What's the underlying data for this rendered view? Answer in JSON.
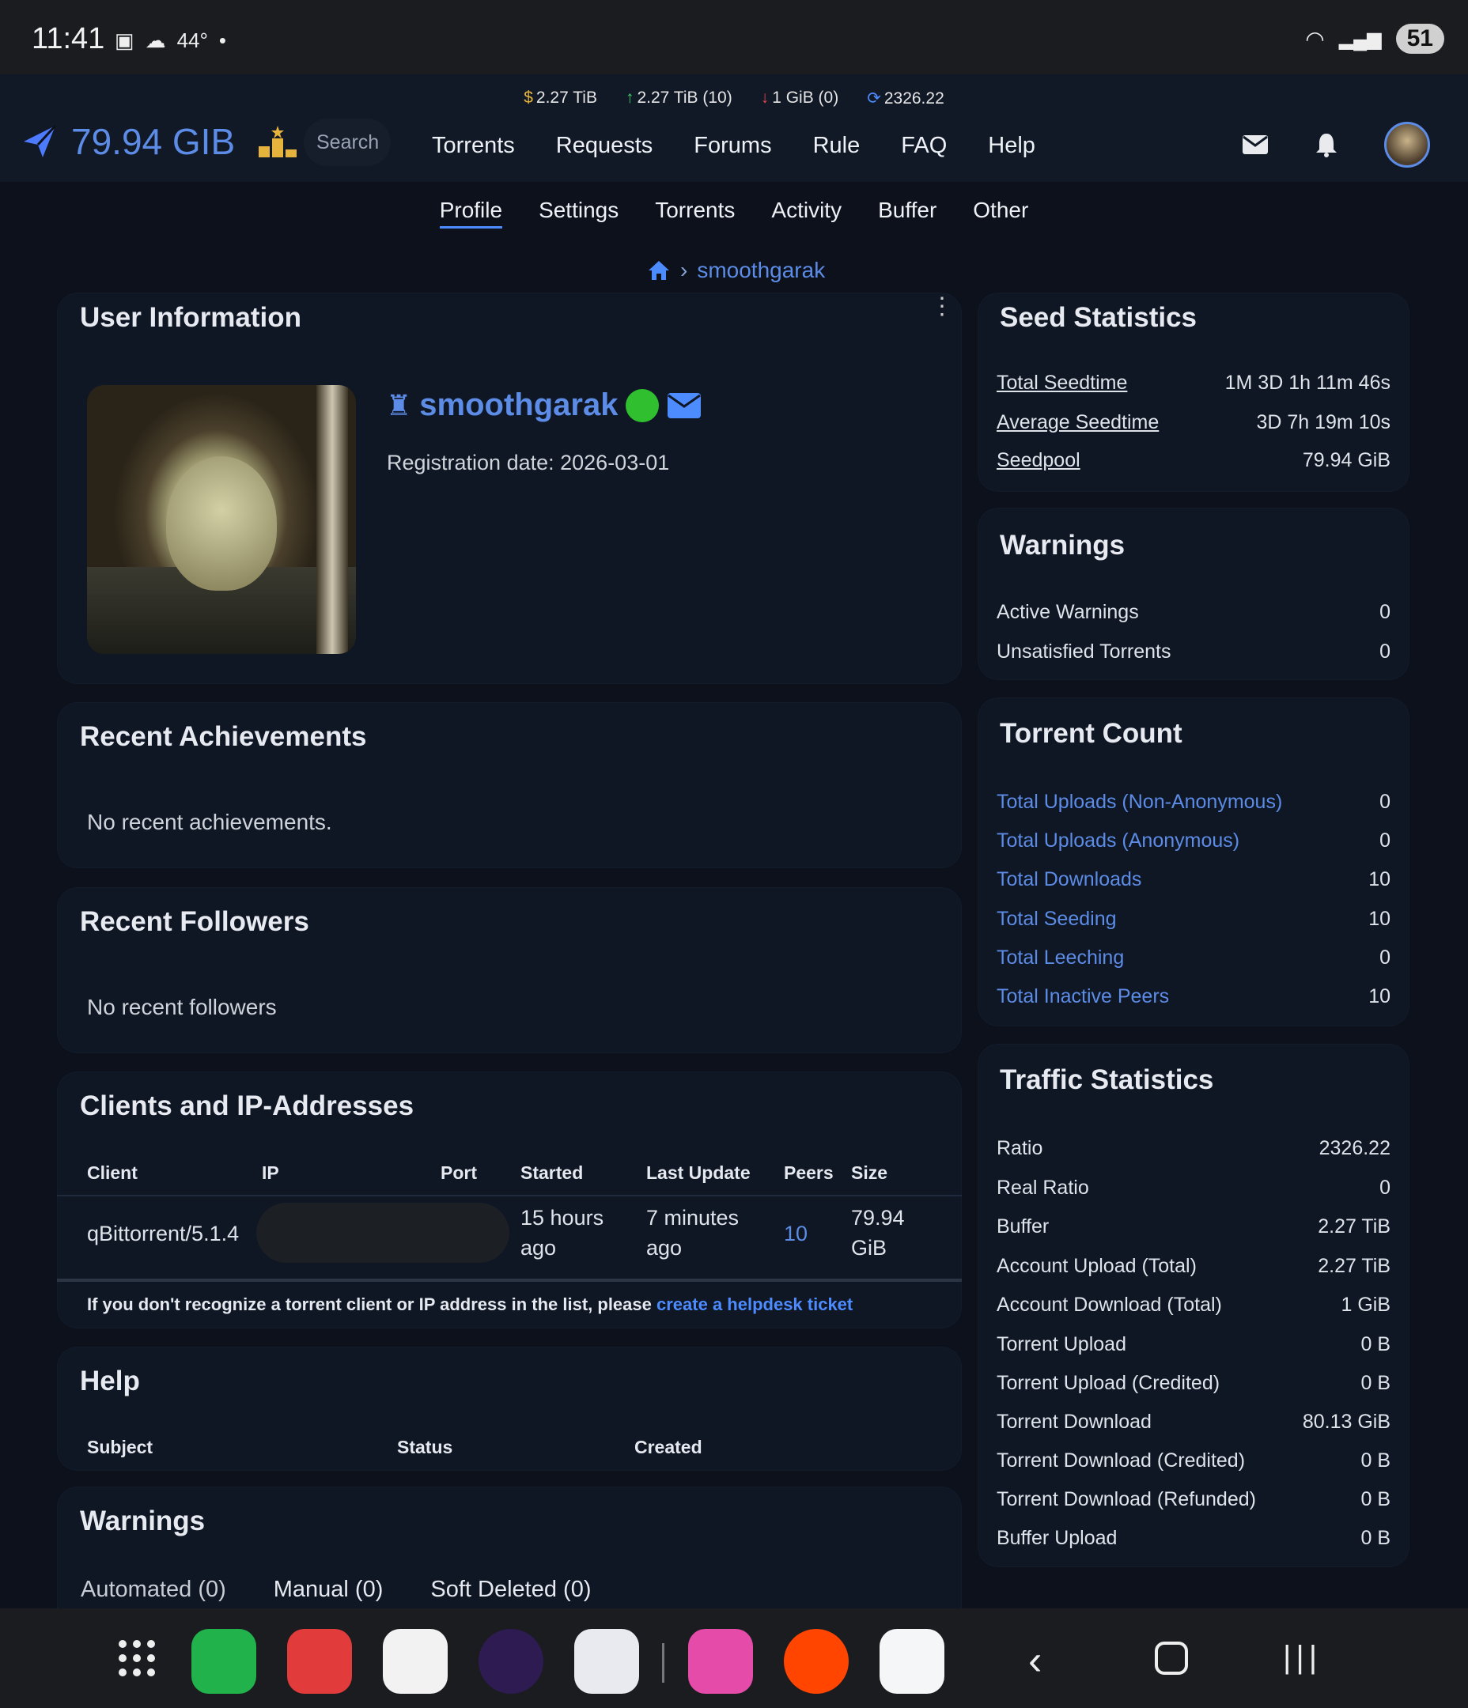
{
  "status_bar": {
    "time": "11:41",
    "temperature": "44°",
    "battery": "51"
  },
  "header": {
    "stats": {
      "bounty": "2.27 TiB",
      "upload": "2.27 TiB (10)",
      "download": "1 GiB (0)",
      "ratio": "2326.22"
    },
    "seedpool": "79.94 GIB",
    "search_placeholder": "Search",
    "nav": [
      "Torrents",
      "Requests",
      "Forums",
      "Rule",
      "FAQ",
      "Help"
    ]
  },
  "subnav": [
    "Profile",
    "Settings",
    "Torrents",
    "Activity",
    "Buffer",
    "Other"
  ],
  "breadcrumb": {
    "user": "smoothgarak"
  },
  "user_info": {
    "title": "User Information",
    "username": "smoothgarak",
    "registration": "Registration date: 2026-03-01"
  },
  "recent_achievements": {
    "title": "Recent Achievements",
    "empty": "No recent achievements."
  },
  "recent_followers": {
    "title": "Recent Followers",
    "empty": "No recent followers"
  },
  "clients": {
    "title": "Clients and IP-Addresses",
    "columns": [
      "Client",
      "IP",
      "Port",
      "Started",
      "Last Update",
      "Peers",
      "Size"
    ],
    "row": {
      "client": "qBittorrent/5.1.4",
      "started_1": "15 hours",
      "started_2": "ago",
      "last_update_1": "7 minutes",
      "last_update_2": "ago",
      "peers": "10",
      "size_1": "79.94",
      "size_2": "GiB"
    },
    "note": "If you don't recognize a torrent client or IP address in the list, please",
    "note_link": "create a helpdesk ticket"
  },
  "help": {
    "title": "Help",
    "columns": [
      "Subject",
      "Status",
      "Created"
    ]
  },
  "warnings_left": {
    "title": "Warnings",
    "tabs": [
      "Automated (0)",
      "Manual (0)",
      "Soft Deleted (0)"
    ]
  },
  "seed_statistics": {
    "title": "Seed Statistics",
    "rows": [
      {
        "label": "Total Seedtime",
        "value": "1M 3D 1h 11m 46s"
      },
      {
        "label": "Average Seedtime",
        "value": "3D 7h 19m 10s"
      },
      {
        "label": "Seedpool",
        "value": "79.94 GiB"
      }
    ]
  },
  "warnings_right": {
    "title": "Warnings",
    "rows": [
      {
        "label": "Active Warnings",
        "value": "0"
      },
      {
        "label": "Unsatisfied Torrents",
        "value": "0"
      }
    ]
  },
  "torrent_count": {
    "title": "Torrent Count",
    "rows": [
      {
        "label": "Total Uploads (Non-Anonymous)",
        "value": "0"
      },
      {
        "label": "Total Uploads (Anonymous)",
        "value": "0"
      },
      {
        "label": "Total Downloads",
        "value": "10"
      },
      {
        "label": "Total Seeding",
        "value": "10"
      },
      {
        "label": "Total Leeching",
        "value": "0"
      },
      {
        "label": "Total Inactive Peers",
        "value": "10"
      }
    ]
  },
  "traffic_statistics": {
    "title": "Traffic Statistics",
    "rows": [
      {
        "label": "Ratio",
        "value": "2326.22"
      },
      {
        "label": "Real Ratio",
        "value": "0"
      },
      {
        "label": "Buffer",
        "value": "2.27 TiB"
      },
      {
        "label": "Account Upload (Total)",
        "value": "2.27 TiB"
      },
      {
        "label": "Account Download (Total)",
        "value": "1 GiB"
      },
      {
        "label": "Torrent Upload",
        "value": "0 B"
      },
      {
        "label": "Torrent Upload (Credited)",
        "value": "0 B"
      },
      {
        "label": "Torrent Download",
        "value": "80.13 GiB"
      },
      {
        "label": "Torrent Download (Credited)",
        "value": "0 B"
      },
      {
        "label": "Torrent Download (Refunded)",
        "value": "0 B"
      },
      {
        "label": "Buffer Upload",
        "value": "0 B"
      }
    ]
  },
  "colors": {
    "accent": "#5c8ce6",
    "online": "#2fbf2f",
    "upload": "#3ccb6a",
    "download": "#e0484d"
  }
}
